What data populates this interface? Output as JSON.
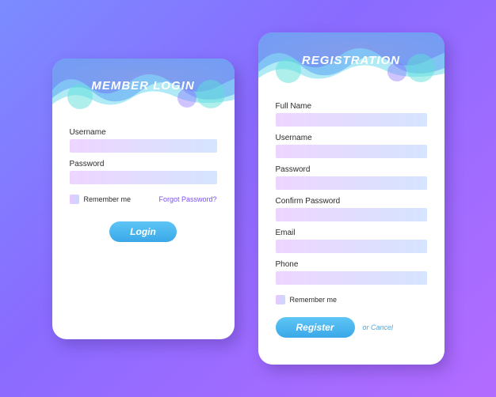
{
  "login": {
    "title": "MEMBER LOGIN",
    "username_label": "Username",
    "password_label": "Password",
    "remember_label": "Remember me",
    "forgot_link": "Forgot Password?",
    "submit_label": "Login"
  },
  "register": {
    "title": "REGISTRATION",
    "fullname_label": "Full Name",
    "username_label": "Username",
    "password_label": "Password",
    "confirm_label": "Confirm Password",
    "email_label": "Email",
    "phone_label": "Phone",
    "remember_label": "Remember me",
    "submit_label": "Register",
    "cancel_label": "or Cancel"
  }
}
